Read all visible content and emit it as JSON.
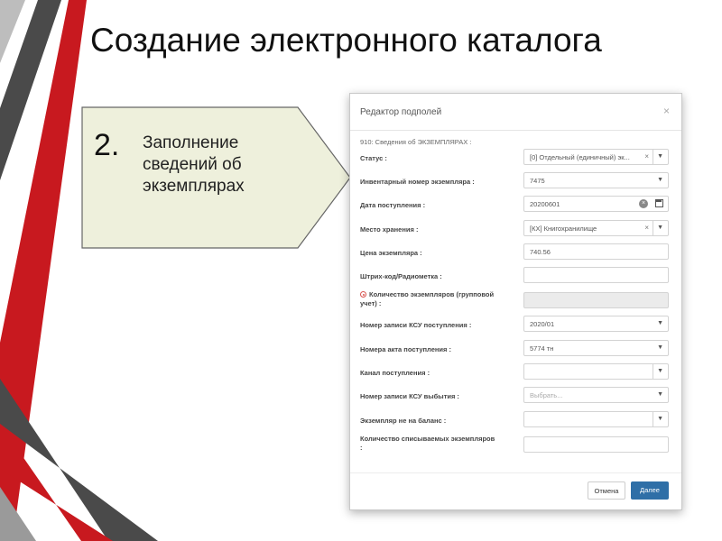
{
  "slide": {
    "title": "Создание электронного каталога",
    "step_number": "2.",
    "step_text": "Заполнение сведений об экземплярах"
  },
  "dialog": {
    "title": "Редактор подполей",
    "close": "×",
    "section": "910: Сведения об ЭКЗЕМПЛЯРАХ :",
    "fields": [
      {
        "label": "Статус :",
        "value": "[0] Отдельный (единичный) эк..."
      },
      {
        "label": "Инвентарный номер экземпляра :",
        "value": "7475"
      },
      {
        "label": "Дата поступления :",
        "value": "20200601"
      },
      {
        "label": "Место хранения :",
        "value": "[КХ] Книгохранилище"
      },
      {
        "label": "Цена экземпляра :",
        "value": "740.56"
      },
      {
        "label": "Штрих-код/Радиометка :",
        "value": ""
      },
      {
        "label": "Количество экземпляров (групповой учет) :",
        "value": ""
      },
      {
        "label": "Номер записи КСУ поступления :",
        "value": "2020/01"
      },
      {
        "label": "Номера акта поступления :",
        "value": "5774 тн"
      },
      {
        "label": "Канал поступления :",
        "value": ""
      },
      {
        "label": "Номер записи КСУ выбытия :",
        "value": "",
        "placeholder": "Выбрать..."
      },
      {
        "label": "Экземпляр не на баланс :",
        "value": ""
      },
      {
        "label": "Количество списываемых экземпляров :",
        "value": ""
      }
    ],
    "buttons": {
      "cancel": "Отмена",
      "next": "Далее"
    }
  },
  "colors": {
    "stripe_red": "#c8191f",
    "stripe_dark": "#4a4a4a",
    "arrow_fill": "#eef0dc",
    "primary_button": "#2f6fa7"
  }
}
